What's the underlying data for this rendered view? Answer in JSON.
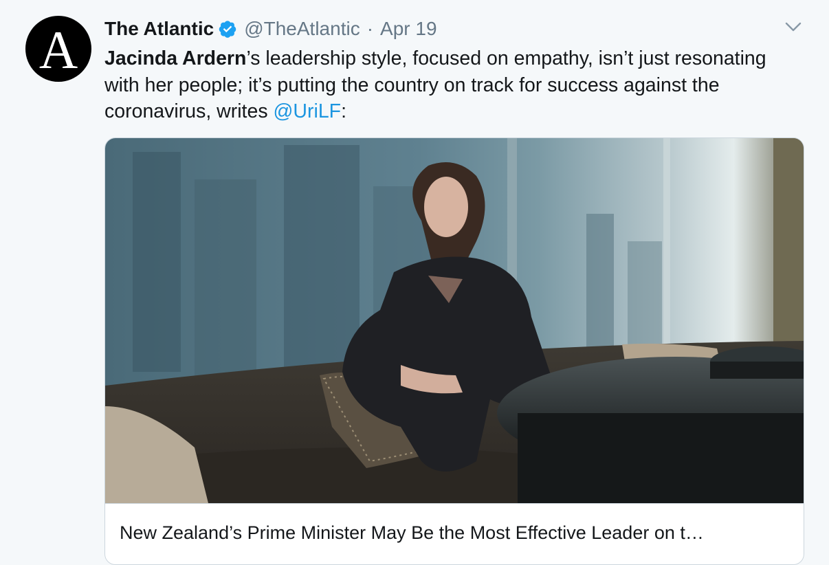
{
  "tweet": {
    "display_name": "The Atlantic",
    "handle": "@TheAtlantic",
    "separator": "·",
    "date": "Apr 19",
    "avatar_letter": "A",
    "text_parts": {
      "bold_name": "Jacinda Ardern",
      "body": "’s leadership style, focused on empathy, isn’t just resonating with her people; it’s putting the country on track for success against the coronavirus, writes ",
      "mention": "@UriLF",
      "end": ":"
    }
  },
  "card": {
    "title": "New Zealand’s Prime Minister May Be the Most Effective Leader on t…"
  },
  "icons": {
    "verified": "verified-badge-icon",
    "menu": "chevron-down-icon"
  },
  "colors": {
    "link": "#1b95e0",
    "verified": "#1da1f2",
    "secondary_text": "#657786",
    "background": "#f5f8fa"
  }
}
